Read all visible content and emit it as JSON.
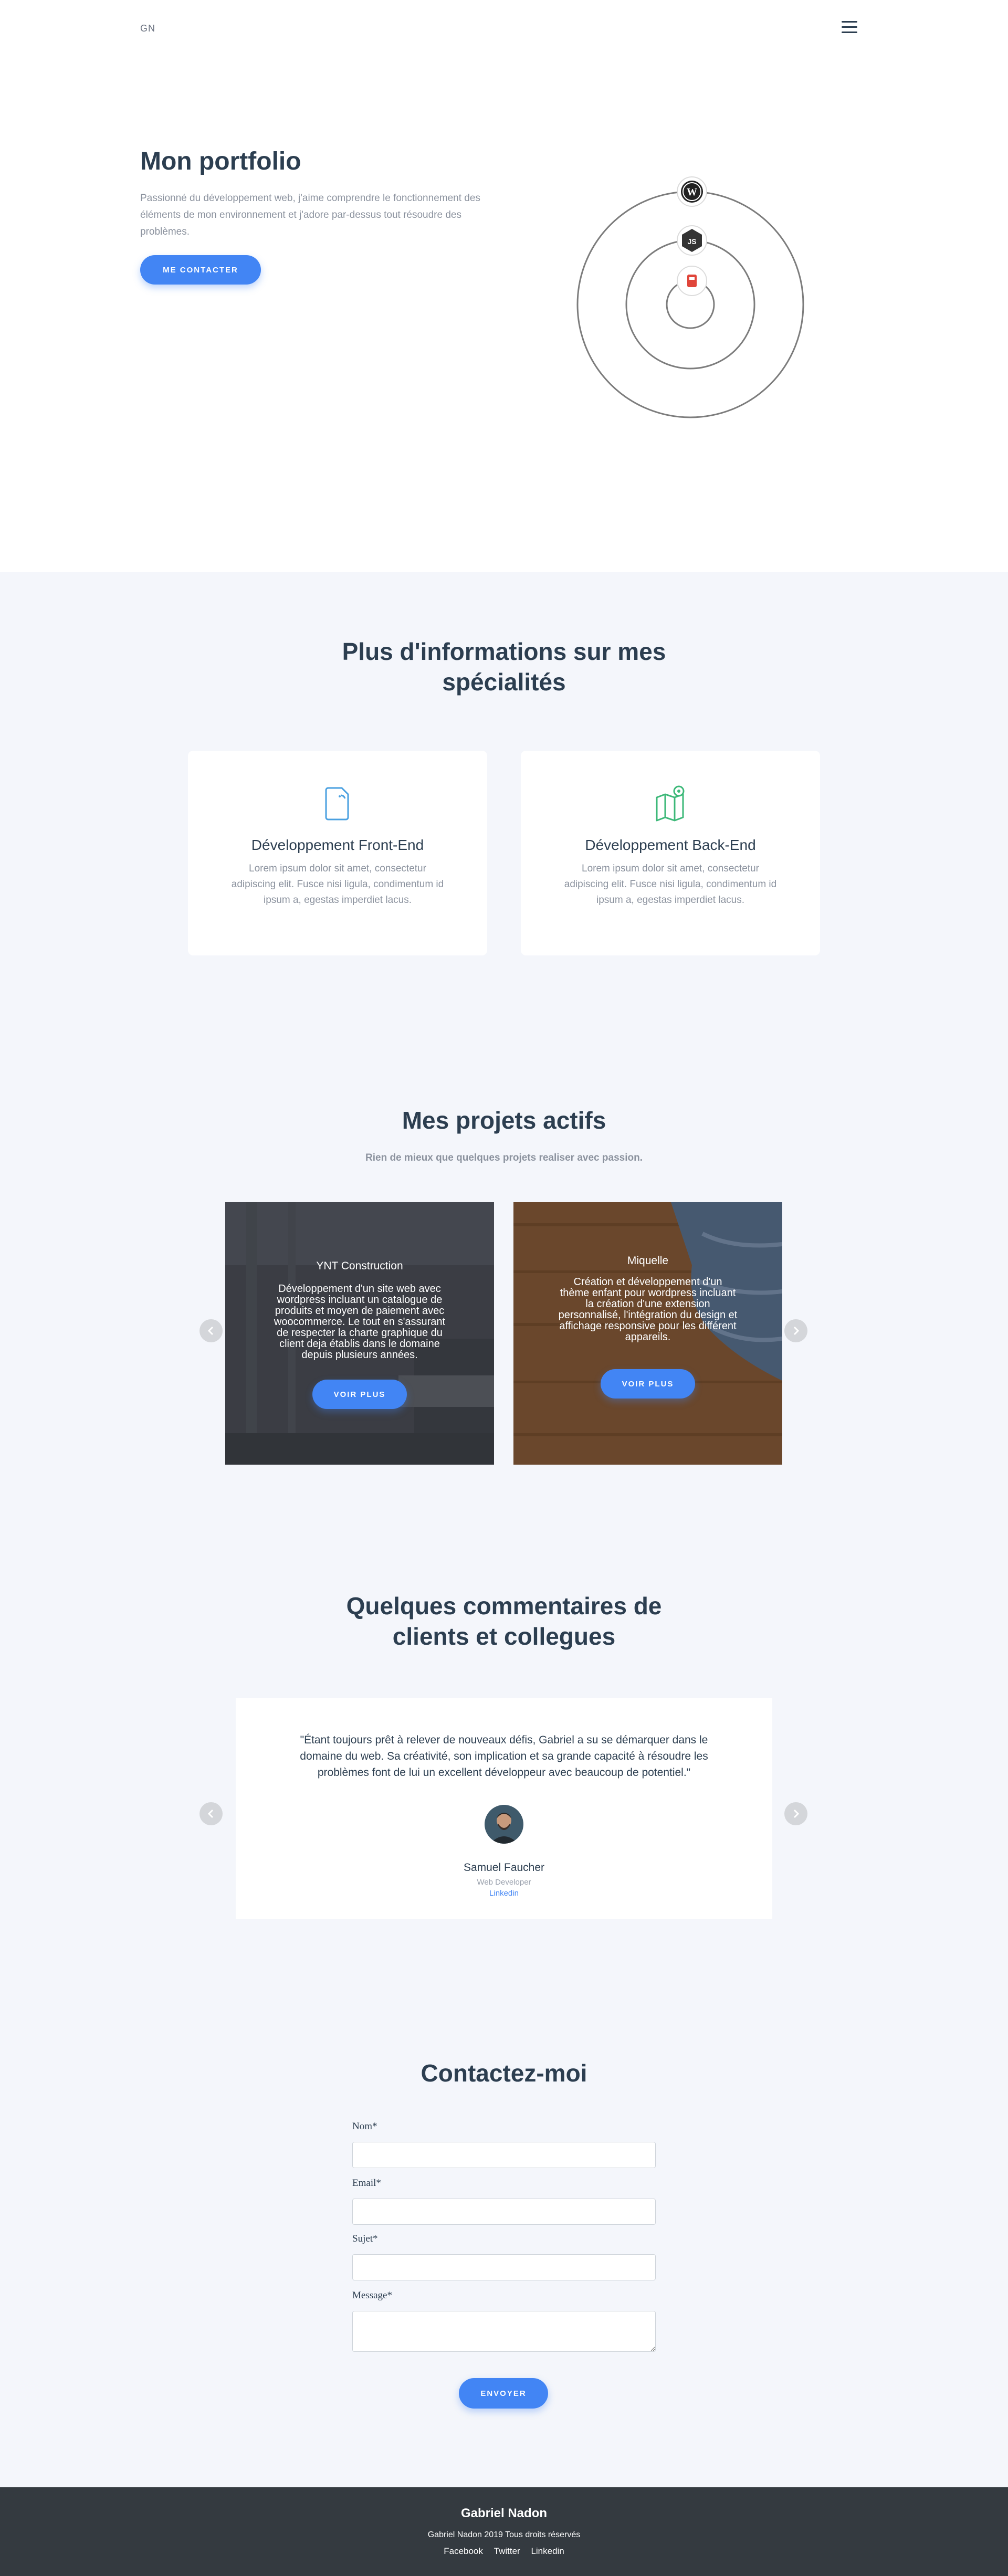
{
  "header": {
    "logo": "GN"
  },
  "hero": {
    "title": "Mon portfolio",
    "text": "Passionné du développement web, j'aime comprendre le fonctionnement des éléments de mon environnement et j'adore par-dessus tout résoudre des problèmes.",
    "button": "ME CONTACTER",
    "orbit_icons": [
      "wordpress-icon",
      "nodejs-icon",
      "laravel-icon"
    ]
  },
  "specialties": {
    "title_line1": "Plus d'informations sur mes",
    "title_line2": "spécialités",
    "cards": [
      {
        "icon": "document-icon",
        "title": "Développement Front-End",
        "text": "Lorem ipsum dolor sit amet, consectetur adipiscing elit. Fusce nisi ligula, condimentum id ipsum a, egestas imperdiet lacus."
      },
      {
        "icon": "map-pin-icon",
        "title": "Développement Back-End",
        "text": "Lorem ipsum dolor sit amet, consectetur adipiscing elit. Fusce nisi ligula, condimentum id ipsum a, egestas imperdiet lacus."
      }
    ]
  },
  "projects": {
    "title": "Mes projets actifs",
    "subtitle": "Rien de mieux que quelques projets realiser avec passion.",
    "items": [
      {
        "title": "YNT Construction",
        "text": "Développement d'un site web avec wordpress incluant un catalogue de produits et moyen de paiement avec woocommerce. Le tout en s'assurant de respecter la charte graphique du client deja établis dans le domaine depuis plusieurs années.",
        "button": "VOIR PLUS"
      },
      {
        "title": "Miquelle",
        "text": "Création et développement d'un thème enfant pour wordpress incluant la création d'une extension personnalisé, l'intégration du design et affichage responsive pour les différent appareils.",
        "button": "VOIR PLUS"
      }
    ]
  },
  "testimonials": {
    "title_line1": "Quelques commentaires de",
    "title_line2": "clients et collegues",
    "quote": "\"Étant toujours prêt à relever de nouveaux défis, Gabriel a su se démarquer dans le domaine du web. Sa créativité, son implication et sa grande capacité à résoudre les problèmes font de lui un excellent développeur avec beaucoup de potentiel.\"",
    "name": "Samuel Faucher",
    "role": "Web Developer",
    "link": "Linkedin"
  },
  "contact": {
    "title": "Contactez-moi",
    "fields": {
      "name": "Nom*",
      "email": "Email*",
      "subject": "Sujet*",
      "message": "Message*"
    },
    "button": "ENVOYER"
  },
  "footer": {
    "name": "Gabriel Nadon",
    "copyright": "Gabriel Nadon 2019 Tous droits réservés",
    "links": [
      "Facebook",
      "Twitter",
      "Linkedin"
    ]
  },
  "colors": {
    "accent": "#4285f4",
    "text": "#2c3e50",
    "muted": "#8b929e",
    "section_bg": "#f4f6fb",
    "footer_bg": "#343a40",
    "green": "#3cb878"
  }
}
